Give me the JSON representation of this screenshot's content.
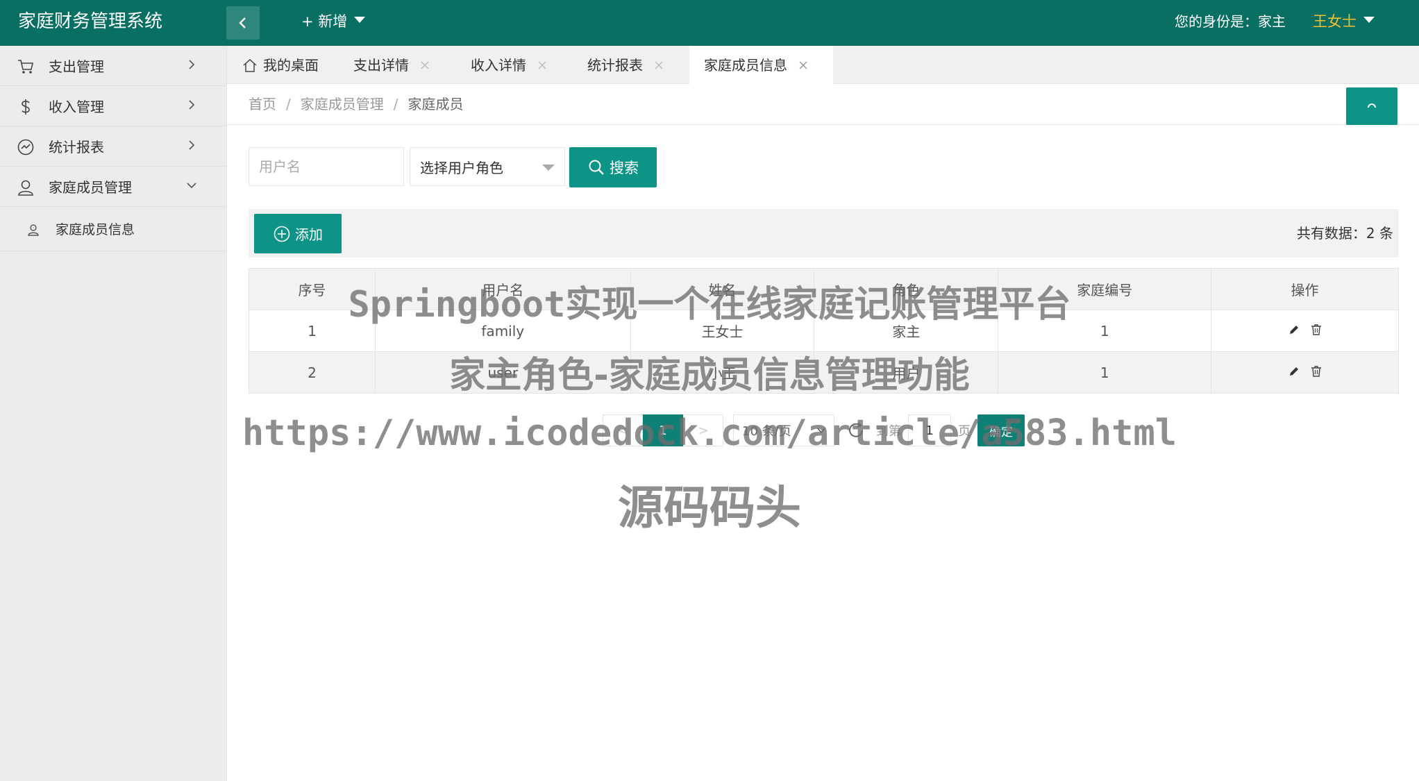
{
  "header": {
    "app_title": "家庭财务管理系统",
    "new_label": "+ 新增",
    "identity_text": "您的身份是：家主",
    "user_name": "王女士"
  },
  "sidebar": {
    "items": [
      {
        "label": "支出管理",
        "icon": "cart-icon",
        "expanded": false
      },
      {
        "label": "收入管理",
        "icon": "dollar-icon",
        "expanded": false
      },
      {
        "label": "统计报表",
        "icon": "chart-icon",
        "expanded": false
      },
      {
        "label": "家庭成员管理",
        "icon": "user-icon",
        "expanded": true
      }
    ],
    "subitems": [
      {
        "label": "家庭成员信息",
        "icon": "user-icon"
      }
    ]
  },
  "tabs": [
    {
      "label": "我的桌面",
      "closable": false,
      "active": false
    },
    {
      "label": "支出详情",
      "closable": true,
      "active": false
    },
    {
      "label": "收入详情",
      "closable": true,
      "active": false
    },
    {
      "label": "统计报表",
      "closable": true,
      "active": false
    },
    {
      "label": "家庭成员信息",
      "closable": true,
      "active": true
    }
  ],
  "breadcrumb": [
    "首页",
    "家庭成员管理",
    "家庭成员"
  ],
  "search": {
    "username_placeholder": "用户名",
    "role_select_value": "选择用户角色",
    "search_label": "搜索"
  },
  "toolbar": {
    "add_label": "添加",
    "total_text": "共有数据：2 条"
  },
  "table": {
    "columns": [
      "序号",
      "用户名",
      "姓名",
      "角色",
      "家庭编号",
      "操作"
    ],
    "rows": [
      [
        "1",
        "family",
        "王女士",
        "家主",
        "1"
      ],
      [
        "2",
        "user",
        "小王",
        "用户",
        "1"
      ]
    ]
  },
  "pagination": {
    "prev": "<",
    "current_page": "1",
    "next": ">",
    "page_size": "10 条/页",
    "goto_label": "到第",
    "goto_value": "1",
    "page_unit": "页",
    "confirm_label": "确定"
  },
  "watermark": {
    "line1": "Springboot实现一个在线家庭记账管理平台",
    "line2": "家主角色-家庭成员信息管理功能",
    "line3": "https://www.icodedock.com/article/a583.html",
    "line4": "源码码头"
  },
  "colors": {
    "header_bg": "#086f62",
    "accent": "#0e9486",
    "user_name": "#f5c130",
    "sidebar_bg": "#ececec"
  }
}
